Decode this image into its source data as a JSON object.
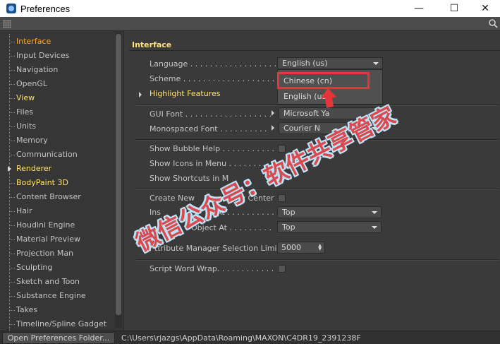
{
  "window": {
    "title": "Preferences",
    "minimize_glyph": "—",
    "maximize_glyph": "☐",
    "close_glyph": "✕"
  },
  "colors": {
    "accent_selected": "#ffad3b",
    "accent_highlight": "#ffe46b",
    "annotation_red": "#e3363a"
  },
  "sidebar": {
    "items": [
      {
        "label": "Interface",
        "state": "selected"
      },
      {
        "label": "Input Devices"
      },
      {
        "label": "Navigation"
      },
      {
        "label": "OpenGL"
      },
      {
        "label": "View",
        "state": "highlight"
      },
      {
        "label": "Files"
      },
      {
        "label": "Units"
      },
      {
        "label": "Memory"
      },
      {
        "label": "Communication"
      },
      {
        "label": "Renderer",
        "state": "highlight",
        "expandable": true
      },
      {
        "label": "BodyPaint 3D",
        "state": "highlight"
      },
      {
        "label": "Content Browser"
      },
      {
        "label": "Hair"
      },
      {
        "label": "Houdini Engine"
      },
      {
        "label": "Material Preview"
      },
      {
        "label": "Projection Man"
      },
      {
        "label": "Sculpting"
      },
      {
        "label": "Sketch and Toon"
      },
      {
        "label": "Substance Engine"
      },
      {
        "label": "Takes"
      },
      {
        "label": "Timeline/Spline Gadget"
      }
    ]
  },
  "panel": {
    "header": "Interface",
    "language_label": "Language . . . . . . . . . . . . . . . . . . . . .",
    "language_value": "English (us)",
    "scheme_label": "Scheme . . . . . . . . . . . . . . . . . . . . . .",
    "highlight_features_label": "Highlight Features",
    "gui_font_label": "GUI Font . . . . . . . . . . . . . . . . . .",
    "gui_font_value": "Microsoft Ya",
    "mono_font_label": "Monospaced Font . . . . . . . . . .",
    "mono_font_value": "Courier N",
    "bubble_help_label": "Show Bubble Help . . . . . . . . . . .",
    "icons_in_menu_label": "Show Icons in Menu . . . . . . . . .",
    "shortcuts_in_menu_label": "Show Shortcuts in M",
    "create_new_label": "Create New",
    "create_new_suffix": "w Center",
    "insert_label": "Ins",
    "insert_suffix": "At . . . . . . . . . .",
    "insert_value": "Top",
    "paste_label": "Object At . . . . . . . . .",
    "paste_value": "Top",
    "attr_limit_label": "ttribute Manager Selection Limit",
    "attr_limit_value": "5000",
    "script_wrap_label": "Script Word Wrap. . . . . . . . . . . .",
    "menu_options": [
      "Chinese (cn)",
      "English (us)"
    ]
  },
  "watermark": "微信公众号：软件共享管家",
  "status": {
    "open_button": "Open Preferences Folder...",
    "path": "C:\\Users\\rjazgs\\AppData\\Roaming\\MAXON\\C4DR19_2391238F"
  }
}
